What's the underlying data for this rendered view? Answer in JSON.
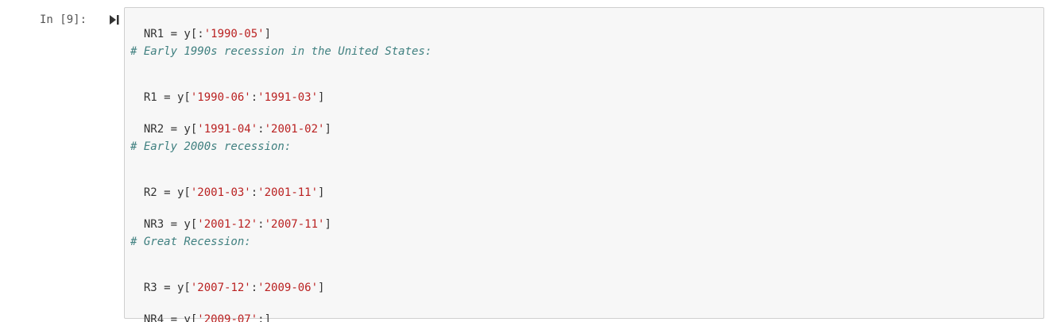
{
  "cell": {
    "prompt": "In [9]:",
    "run_icon": "run-cell-icon",
    "lines": [
      {
        "type": "code",
        "pre": "NR1 = y[:",
        "str1": "'1990-05'",
        "mid": "",
        "str2": "",
        "post": "]"
      },
      {
        "type": "comment",
        "text": "# Early 1990s recession in the United States:"
      },
      {
        "type": "code",
        "pre": "R1 = y[",
        "str1": "'1990-06'",
        "mid": ":",
        "str2": "'1991-03'",
        "post": "]"
      },
      {
        "type": "code",
        "pre": "NR2 = y[",
        "str1": "'1991-04'",
        "mid": ":",
        "str2": "'2001-02'",
        "post": "]"
      },
      {
        "type": "comment",
        "text": "# Early 2000s recession:"
      },
      {
        "type": "code",
        "pre": "R2 = y[",
        "str1": "'2001-03'",
        "mid": ":",
        "str2": "'2001-11'",
        "post": "]"
      },
      {
        "type": "code",
        "pre": "NR3 = y[",
        "str1": "'2001-12'",
        "mid": ":",
        "str2": "'2007-11'",
        "post": "]"
      },
      {
        "type": "comment",
        "text": "# Great Recession:"
      },
      {
        "type": "code",
        "pre": "R3 = y[",
        "str1": "'2007-12'",
        "mid": ":",
        "str2": "'2009-06'",
        "post": "]"
      },
      {
        "type": "code",
        "pre": "NR4 = y[",
        "str1": "'2009-07'",
        "mid": ":",
        "str2": "",
        "post": "]"
      }
    ]
  },
  "colors": {
    "string": "#ba2121",
    "comment": "#408080",
    "cell_background": "#f7f7f7",
    "cell_border": "#cfcfcf"
  }
}
